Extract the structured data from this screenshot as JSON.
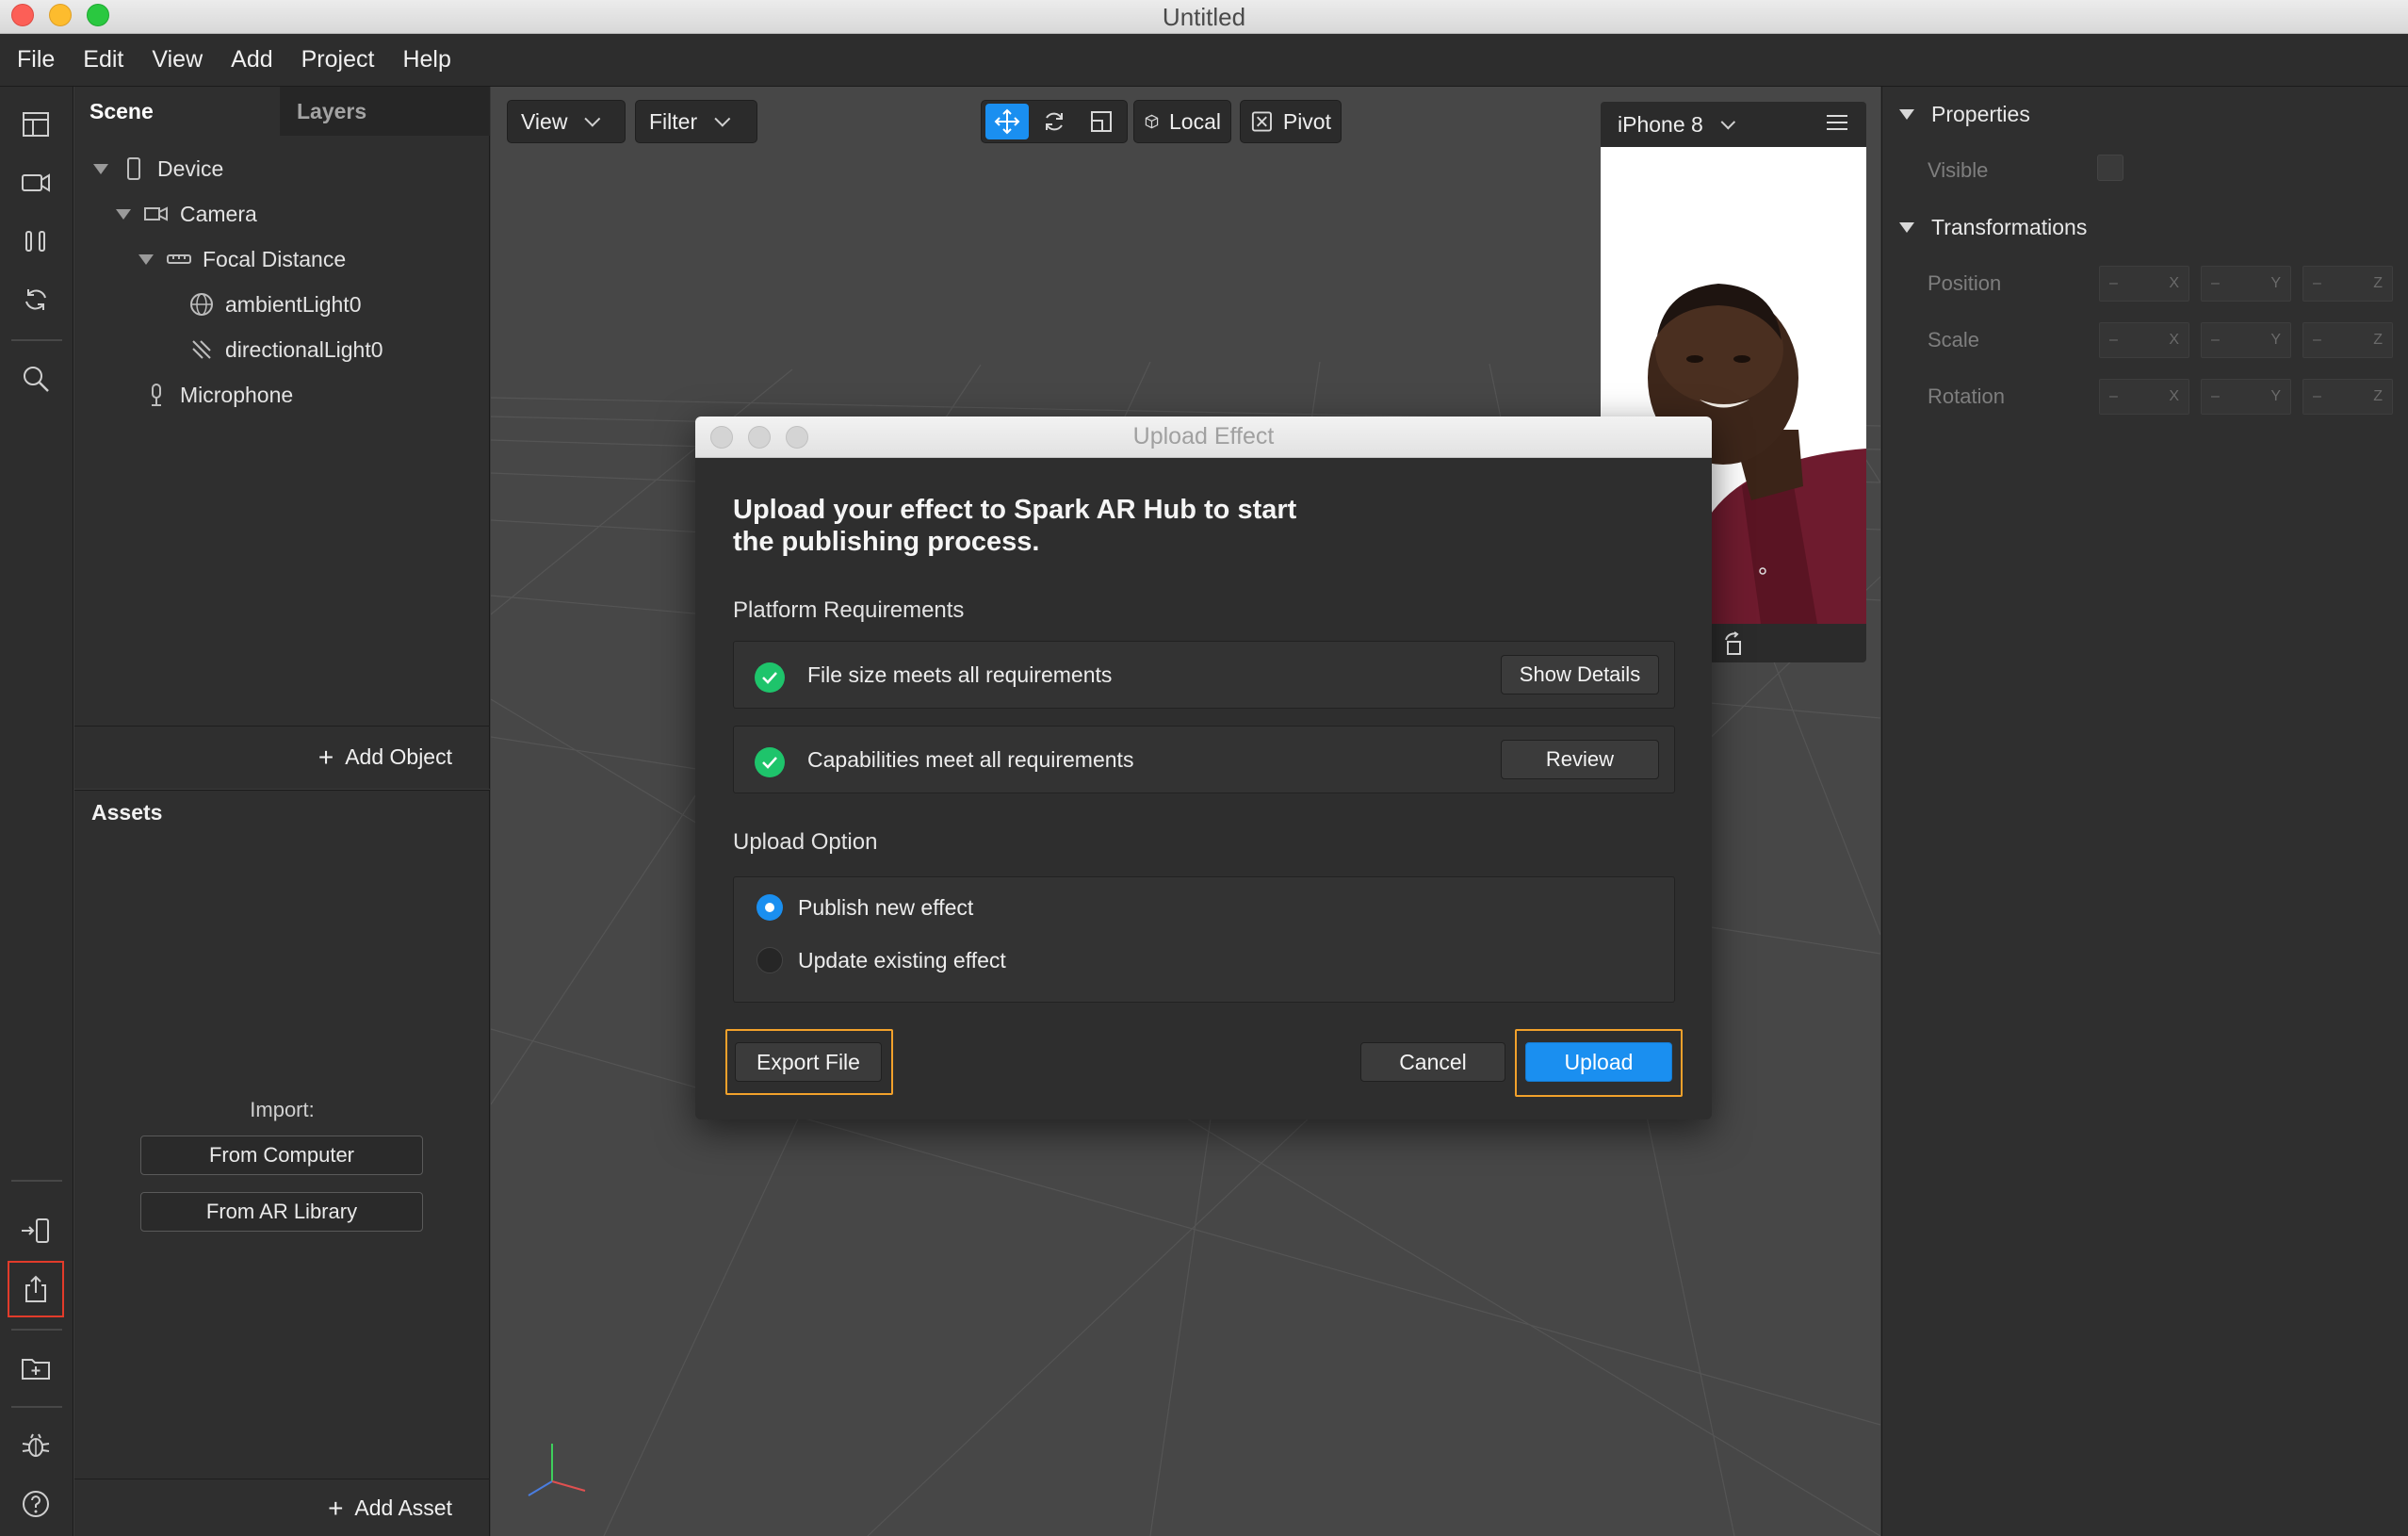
{
  "window": {
    "title": "Untitled"
  },
  "menu": [
    "File",
    "Edit",
    "View",
    "Add",
    "Project",
    "Help"
  ],
  "scene": {
    "tabs": [
      "Scene",
      "Layers"
    ],
    "tree": [
      {
        "label": "Device",
        "icon": "device-icon"
      },
      {
        "label": "Camera",
        "icon": "camera-icon"
      },
      {
        "label": "Focal Distance",
        "icon": "focal-distance-icon"
      },
      {
        "label": "ambientLight0",
        "icon": "ambient-light-icon"
      },
      {
        "label": "directionalLight0",
        "icon": "directional-light-icon"
      },
      {
        "label": "Microphone",
        "icon": "microphone-icon"
      }
    ],
    "add_object": "Add Object"
  },
  "assets": {
    "title": "Assets",
    "import_label": "Import:",
    "from_computer": "From Computer",
    "from_library": "From AR Library",
    "add_asset": "Add Asset"
  },
  "viewport": {
    "view_label": "View",
    "filter_label": "Filter",
    "local_label": "Local",
    "pivot_label": "Pivot"
  },
  "preview": {
    "device": "iPhone 8"
  },
  "properties": {
    "properties_header": "Properties",
    "visible_label": "Visible",
    "transformations_header": "Transformations",
    "rows": [
      "Position",
      "Scale",
      "Rotation"
    ],
    "field_placeholder": "–",
    "axes": [
      "X",
      "Y",
      "Z"
    ]
  },
  "modal": {
    "title": "Upload Effect",
    "heading_line1": "Upload your effect to Spark AR Hub to start",
    "heading_line2": "the publishing process.",
    "platform_requirements": "Platform Requirements",
    "req1_text": "File size meets all requirements",
    "req1_button": "Show Details",
    "req2_text": "Capabilities meet all requirements",
    "req2_button": "Review",
    "upload_option": "Upload Option",
    "option1": "Publish new effect",
    "option2": "Update existing effect",
    "export_button": "Export File",
    "cancel_button": "Cancel",
    "upload_button": "Upload"
  },
  "colors": {
    "accent": "#1a8ff0",
    "success": "#1ec46b",
    "highlight": "#f2a12b",
    "rail_highlight": "#e23b2a"
  }
}
